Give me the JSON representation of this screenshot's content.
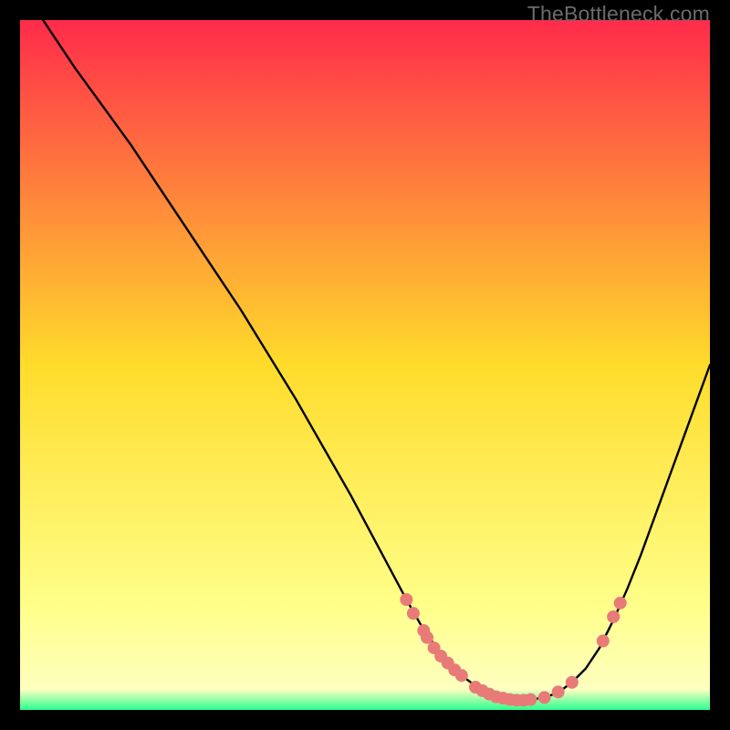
{
  "watermark": "TheBottleneck.com",
  "colors": {
    "gradient_top": "#ff2b4b",
    "gradient_mid": "#ffdc2b",
    "gradient_bottom_yellow": "#ffff8a",
    "gradient_green": "#2bff8f",
    "curve": "#000000",
    "marker": "#e87b78",
    "frame": "#000000"
  },
  "chart_data": {
    "type": "line",
    "title": "",
    "xlabel": "",
    "ylabel": "",
    "xlim": [
      0,
      100
    ],
    "ylim": [
      0,
      100
    ],
    "curve": {
      "x": [
        0,
        4,
        8,
        12,
        16,
        20,
        24,
        28,
        32,
        36,
        40,
        44,
        48,
        52,
        56,
        58,
        60,
        62,
        64,
        66,
        68,
        70,
        72,
        74,
        76,
        78,
        80,
        82,
        84,
        86,
        88,
        90,
        92,
        94,
        96,
        98,
        100
      ],
      "y": [
        105,
        99,
        93,
        87.5,
        82,
        76,
        70,
        64,
        58,
        51.5,
        45,
        38,
        31,
        23.5,
        16,
        12.5,
        9.5,
        7,
        5,
        3.5,
        2.4,
        1.8,
        1.5,
        1.5,
        1.8,
        2.5,
        4,
        6,
        9,
        13,
        17.5,
        22.5,
        28,
        33.5,
        39,
        44.5,
        50
      ]
    },
    "markers": [
      {
        "x": 56,
        "y": 16
      },
      {
        "x": 57,
        "y": 14
      },
      {
        "x": 58.5,
        "y": 11.5
      },
      {
        "x": 59,
        "y": 10.5
      },
      {
        "x": 60,
        "y": 9
      },
      {
        "x": 61,
        "y": 7.8
      },
      {
        "x": 62,
        "y": 6.8
      },
      {
        "x": 63,
        "y": 5.8
      },
      {
        "x": 64,
        "y": 5
      },
      {
        "x": 66,
        "y": 3.3
      },
      {
        "x": 67,
        "y": 2.8
      },
      {
        "x": 68,
        "y": 2.3
      },
      {
        "x": 69,
        "y": 1.9
      },
      {
        "x": 70,
        "y": 1.7
      },
      {
        "x": 71,
        "y": 1.5
      },
      {
        "x": 72,
        "y": 1.4
      },
      {
        "x": 73,
        "y": 1.4
      },
      {
        "x": 74,
        "y": 1.5
      },
      {
        "x": 76,
        "y": 1.8
      },
      {
        "x": 78,
        "y": 2.6
      },
      {
        "x": 80,
        "y": 4.0
      },
      {
        "x": 84.5,
        "y": 10
      },
      {
        "x": 86,
        "y": 13.5
      },
      {
        "x": 87,
        "y": 15.5
      }
    ]
  }
}
